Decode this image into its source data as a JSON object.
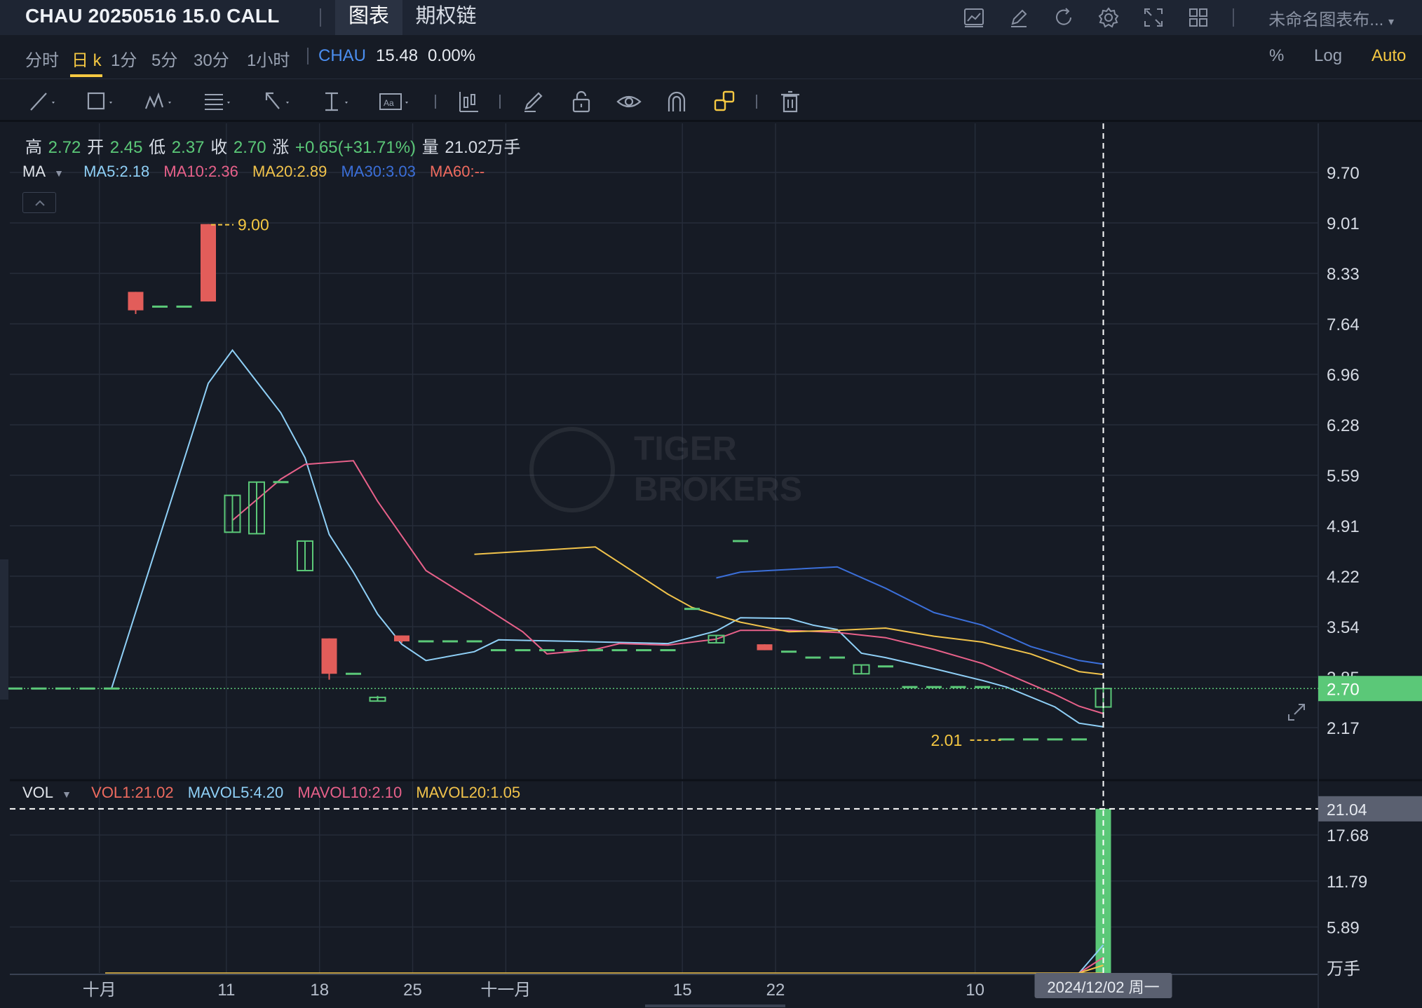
{
  "header": {
    "contract": "CHAU 20250516 15.0 CALL",
    "tabs": [
      {
        "label": "图表",
        "active": true
      },
      {
        "label": "期权链",
        "active": false
      }
    ],
    "icons": [
      "chart-line-icon",
      "pencil-icon",
      "refresh-icon",
      "gear-icon",
      "fullscreen-icon",
      "layout-grid-icon"
    ],
    "layout_name": "未命名图表布..."
  },
  "periods": {
    "items": [
      "分时",
      "日 k",
      "1分",
      "5分",
      "30分",
      "1小时"
    ],
    "active": "日 k",
    "symbol": "CHAU",
    "symbol_price": "15.48",
    "symbol_change": "0.00%",
    "right_items": [
      "%",
      "Log",
      "Auto"
    ],
    "right_active": "Auto"
  },
  "toolbar": {
    "tools": [
      "trend-line-icon",
      "rectangle-icon",
      "pattern-icon",
      "fib-icon",
      "arrow-icon",
      "measure-icon",
      "text-icon",
      "indicator-icon",
      "brush-icon",
      "lock-icon",
      "eye-icon",
      "magnet-icon",
      "link-icon",
      "trash-icon"
    ]
  },
  "ohlc": {
    "high_label": "高",
    "high": "2.72",
    "open_label": "开",
    "open": "2.45",
    "low_label": "低",
    "low": "2.37",
    "close_label": "收",
    "close": "2.70",
    "change_label": "涨",
    "change": "+0.65(+31.71%)",
    "volume_label": "量",
    "volume": "21.02万手"
  },
  "ma_legend": {
    "name": "MA",
    "items": [
      {
        "text": "MA5:2.18",
        "color": "#8fd0f7"
      },
      {
        "text": "MA10:2.36",
        "color": "#e8618a"
      },
      {
        "text": "MA20:2.89",
        "color": "#f1c34b"
      },
      {
        "text": "MA30:3.03",
        "color": "#3b6fd9"
      },
      {
        "text": "MA60:--",
        "color": "#ef6b5f"
      }
    ]
  },
  "vol_legend": {
    "name": "VOL",
    "items": [
      {
        "text": "VOL1:21.02",
        "color": "#ef6b5f"
      },
      {
        "text": "MAVOL5:4.20",
        "color": "#8fd0f7"
      },
      {
        "text": "MAVOL10:2.10",
        "color": "#e8618a"
      },
      {
        "text": "MAVOL20:1.05",
        "color": "#f1c34b"
      }
    ]
  },
  "colors": {
    "up": "#5bc878",
    "down": "#e25d5a",
    "bg": "#161b25",
    "grid": "#262d3a"
  },
  "chart_data": {
    "type": "candlestick",
    "price_axis": {
      "ticks": [
        "9.70",
        "9.01",
        "8.33",
        "7.64",
        "6.96",
        "6.28",
        "5.59",
        "4.91",
        "4.22",
        "3.54",
        "2.85",
        "2.17"
      ],
      "ylim": [
        2.17,
        9.7
      ],
      "current_price": "2.70",
      "max_marker": "9.00",
      "min_marker": "2.01"
    },
    "volume_axis": {
      "ticks": [
        "17.68",
        "11.79",
        "5.89"
      ],
      "unit": "万手",
      "crosshair_value": "21.04"
    },
    "x_ticks": [
      "十月",
      "11",
      "18",
      "25",
      "十一月",
      "15",
      "22",
      "10"
    ],
    "crosshair_date": "2024/12/02 周一",
    "watermark": [
      "TIGER",
      "BROKERS"
    ],
    "candles": [
      {
        "i": 0,
        "o": 2.7,
        "h": 2.7,
        "l": 2.7,
        "c": 2.7
      },
      {
        "i": 1,
        "o": 2.7,
        "h": 2.7,
        "l": 2.7,
        "c": 2.7
      },
      {
        "i": 2,
        "o": 2.7,
        "h": 2.7,
        "l": 2.7,
        "c": 2.7
      },
      {
        "i": 3,
        "o": 2.7,
        "h": 2.7,
        "l": 2.7,
        "c": 2.7
      },
      {
        "i": 4,
        "o": 2.7,
        "h": 2.7,
        "l": 2.7,
        "c": 2.7
      },
      {
        "i": 5,
        "o": 8.08,
        "h": 8.08,
        "l": 7.78,
        "c": 7.83
      },
      {
        "i": 6,
        "o": 7.88,
        "h": 7.88,
        "l": 7.88,
        "c": 7.88
      },
      {
        "i": 7,
        "o": 7.88,
        "h": 7.88,
        "l": 7.88,
        "c": 7.88
      },
      {
        "i": 8,
        "o": 9.0,
        "h": 9.0,
        "l": 7.95,
        "c": 7.95
      },
      {
        "i": 9,
        "o": 4.82,
        "h": 5.32,
        "l": 4.82,
        "c": 5.32
      },
      {
        "i": 10,
        "o": 4.8,
        "h": 5.5,
        "l": 4.8,
        "c": 5.5
      },
      {
        "i": 11,
        "o": 5.5,
        "h": 5.5,
        "l": 5.5,
        "c": 5.5
      },
      {
        "i": 12,
        "o": 4.3,
        "h": 4.7,
        "l": 4.3,
        "c": 4.7
      },
      {
        "i": 13,
        "o": 3.38,
        "h": 3.38,
        "l": 2.82,
        "c": 2.9
      },
      {
        "i": 14,
        "o": 2.9,
        "h": 2.9,
        "l": 2.9,
        "c": 2.9
      },
      {
        "i": 15,
        "o": 2.53,
        "h": 2.6,
        "l": 2.53,
        "c": 2.58
      },
      {
        "i": 16,
        "o": 3.42,
        "h": 3.42,
        "l": 3.32,
        "c": 3.34
      },
      {
        "i": 17,
        "o": 3.34,
        "h": 3.34,
        "l": 3.34,
        "c": 3.34
      },
      {
        "i": 18,
        "o": 3.34,
        "h": 3.34,
        "l": 3.34,
        "c": 3.34
      },
      {
        "i": 19,
        "o": 3.34,
        "h": 3.34,
        "l": 3.34,
        "c": 3.34
      },
      {
        "i": 20,
        "o": 3.22,
        "h": 3.22,
        "l": 3.22,
        "c": 3.22
      },
      {
        "i": 21,
        "o": 3.22,
        "h": 3.22,
        "l": 3.22,
        "c": 3.22
      },
      {
        "i": 22,
        "o": 3.22,
        "h": 3.22,
        "l": 3.22,
        "c": 3.22
      },
      {
        "i": 23,
        "o": 3.22,
        "h": 3.22,
        "l": 3.22,
        "c": 3.22
      },
      {
        "i": 24,
        "o": 3.22,
        "h": 3.22,
        "l": 3.22,
        "c": 3.22
      },
      {
        "i": 25,
        "o": 3.22,
        "h": 3.22,
        "l": 3.22,
        "c": 3.22
      },
      {
        "i": 26,
        "o": 3.22,
        "h": 3.22,
        "l": 3.22,
        "c": 3.22
      },
      {
        "i": 27,
        "o": 3.22,
        "h": 3.22,
        "l": 3.22,
        "c": 3.22
      },
      {
        "i": 28,
        "o": 3.78,
        "h": 3.78,
        "l": 3.78,
        "c": 3.78
      },
      {
        "i": 29,
        "o": 3.32,
        "h": 3.42,
        "l": 3.32,
        "c": 3.42
      },
      {
        "i": 30,
        "o": 4.7,
        "h": 4.7,
        "l": 4.7,
        "c": 4.7
      },
      {
        "i": 31,
        "o": 3.3,
        "h": 3.3,
        "l": 3.22,
        "c": 3.22
      },
      {
        "i": 32,
        "o": 3.2,
        "h": 3.2,
        "l": 3.2,
        "c": 3.2
      },
      {
        "i": 33,
        "o": 3.12,
        "h": 3.12,
        "l": 3.12,
        "c": 3.12
      },
      {
        "i": 34,
        "o": 3.12,
        "h": 3.12,
        "l": 3.12,
        "c": 3.12
      },
      {
        "i": 35,
        "o": 2.9,
        "h": 3.02,
        "l": 2.9,
        "c": 3.02
      },
      {
        "i": 36,
        "o": 3.0,
        "h": 3.0,
        "l": 3.0,
        "c": 3.0
      },
      {
        "i": 37,
        "o": 2.72,
        "h": 2.72,
        "l": 2.72,
        "c": 2.72
      },
      {
        "i": 38,
        "o": 2.72,
        "h": 2.72,
        "l": 2.72,
        "c": 2.72
      },
      {
        "i": 39,
        "o": 2.72,
        "h": 2.72,
        "l": 2.72,
        "c": 2.72
      },
      {
        "i": 40,
        "o": 2.72,
        "h": 2.72,
        "l": 2.72,
        "c": 2.72
      },
      {
        "i": 41,
        "o": 2.01,
        "h": 2.01,
        "l": 2.01,
        "c": 2.01
      },
      {
        "i": 42,
        "o": 2.01,
        "h": 2.01,
        "l": 2.01,
        "c": 2.01
      },
      {
        "i": 43,
        "o": 2.01,
        "h": 2.01,
        "l": 2.01,
        "c": 2.01
      },
      {
        "i": 44,
        "o": 2.01,
        "h": 2.01,
        "l": 2.01,
        "c": 2.01
      },
      {
        "i": 45,
        "o": 2.45,
        "h": 2.72,
        "l": 2.37,
        "c": 2.7
      }
    ],
    "ma_series": [
      {
        "name": "MA5",
        "color": "#8fd0f7",
        "values": [
          [
            4,
            2.7
          ],
          [
            8,
            6.84
          ],
          [
            9,
            7.29
          ],
          [
            11,
            6.44
          ],
          [
            12,
            5.83
          ],
          [
            13,
            4.79
          ],
          [
            14,
            4.28
          ],
          [
            15,
            3.71
          ],
          [
            16,
            3.3
          ],
          [
            17,
            3.08
          ],
          [
            19,
            3.2
          ],
          [
            20,
            3.36
          ],
          [
            23,
            3.34
          ],
          [
            27,
            3.31
          ],
          [
            29,
            3.48
          ],
          [
            30,
            3.66
          ],
          [
            32,
            3.65
          ],
          [
            33,
            3.56
          ],
          [
            34,
            3.5
          ],
          [
            35,
            3.18
          ],
          [
            36,
            3.12
          ],
          [
            38,
            2.97
          ],
          [
            40,
            2.81
          ],
          [
            41,
            2.72
          ],
          [
            43,
            2.45
          ],
          [
            44,
            2.23
          ],
          [
            45,
            2.18
          ]
        ]
      },
      {
        "name": "MA10",
        "color": "#e8618a",
        "values": [
          [
            9,
            4.98
          ],
          [
            11,
            5.54
          ],
          [
            12,
            5.74
          ],
          [
            14,
            5.79
          ],
          [
            15,
            5.24
          ],
          [
            17,
            4.3
          ],
          [
            19,
            3.89
          ],
          [
            21,
            3.47
          ],
          [
            22,
            3.17
          ],
          [
            24,
            3.23
          ],
          [
            25,
            3.31
          ],
          [
            27,
            3.29
          ],
          [
            29,
            3.37
          ],
          [
            30,
            3.49
          ],
          [
            32,
            3.49
          ],
          [
            34,
            3.46
          ],
          [
            36,
            3.39
          ],
          [
            38,
            3.23
          ],
          [
            40,
            3.04
          ],
          [
            41,
            2.9
          ],
          [
            43,
            2.62
          ],
          [
            44,
            2.46
          ],
          [
            45,
            2.36
          ]
        ]
      },
      {
        "name": "MA20",
        "color": "#f1c34b",
        "values": [
          [
            19,
            4.52
          ],
          [
            24,
            4.62
          ],
          [
            27,
            3.98
          ],
          [
            28,
            3.8
          ],
          [
            30,
            3.6
          ],
          [
            32,
            3.47
          ],
          [
            34,
            3.49
          ],
          [
            36,
            3.52
          ],
          [
            38,
            3.41
          ],
          [
            40,
            3.33
          ],
          [
            42,
            3.17
          ],
          [
            44,
            2.93
          ],
          [
            45,
            2.89
          ]
        ]
      },
      {
        "name": "MA30",
        "color": "#3b6fd9",
        "values": [
          [
            29,
            4.2
          ],
          [
            30,
            4.28
          ],
          [
            34,
            4.35
          ],
          [
            36,
            4.06
          ],
          [
            38,
            3.73
          ],
          [
            40,
            3.56
          ],
          [
            42,
            3.27
          ],
          [
            44,
            3.08
          ],
          [
            45,
            3.03
          ]
        ]
      }
    ],
    "volume": {
      "values": [
        0,
        0,
        0,
        0,
        0,
        0,
        0,
        0,
        0,
        0,
        0,
        0,
        0,
        0,
        0,
        0,
        0,
        0,
        0,
        0,
        0,
        0,
        0,
        0,
        0,
        0,
        0,
        0,
        0,
        0,
        0,
        0,
        0,
        0,
        0,
        0,
        0,
        0,
        0,
        0,
        0,
        0,
        0,
        0,
        0,
        21.04
      ]
    }
  }
}
